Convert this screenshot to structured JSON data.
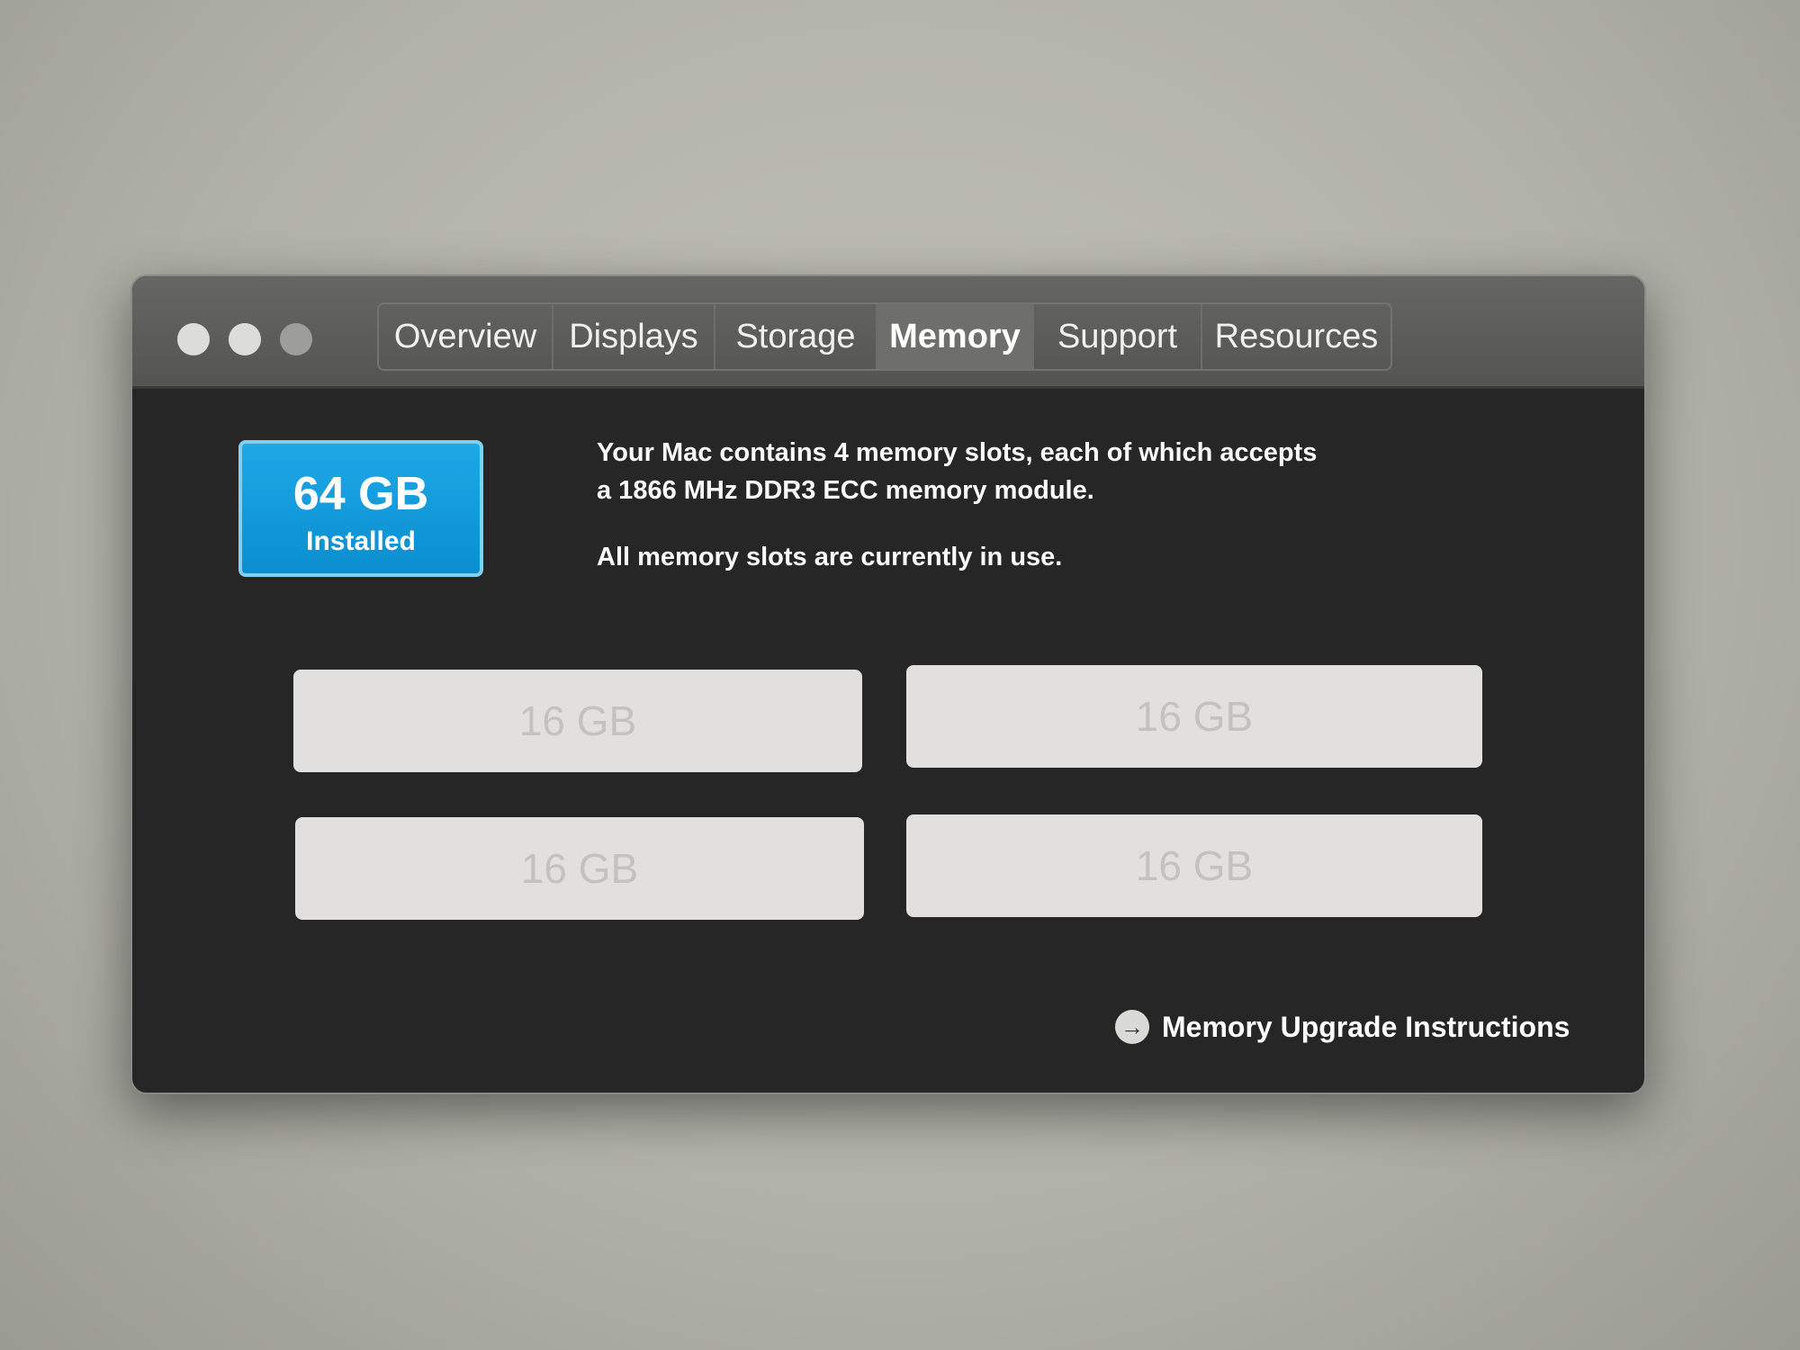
{
  "window": {
    "tabs": [
      "Overview",
      "Displays",
      "Storage",
      "Memory",
      "Support",
      "Resources"
    ],
    "active_tab": "Memory"
  },
  "memory": {
    "installed_amount": "64 GB",
    "installed_label": "Installed",
    "description_line1": "Your Mac contains 4 memory slots, each of which accepts",
    "description_line2": "a 1866 MHz DDR3 ECC memory module.",
    "status": "All memory slots are currently in use.",
    "slots": [
      "16 GB",
      "16 GB",
      "16 GB",
      "16 GB"
    ],
    "upgrade_link": "Memory Upgrade Instructions"
  },
  "colors": {
    "badge": "#0a8ed0"
  }
}
